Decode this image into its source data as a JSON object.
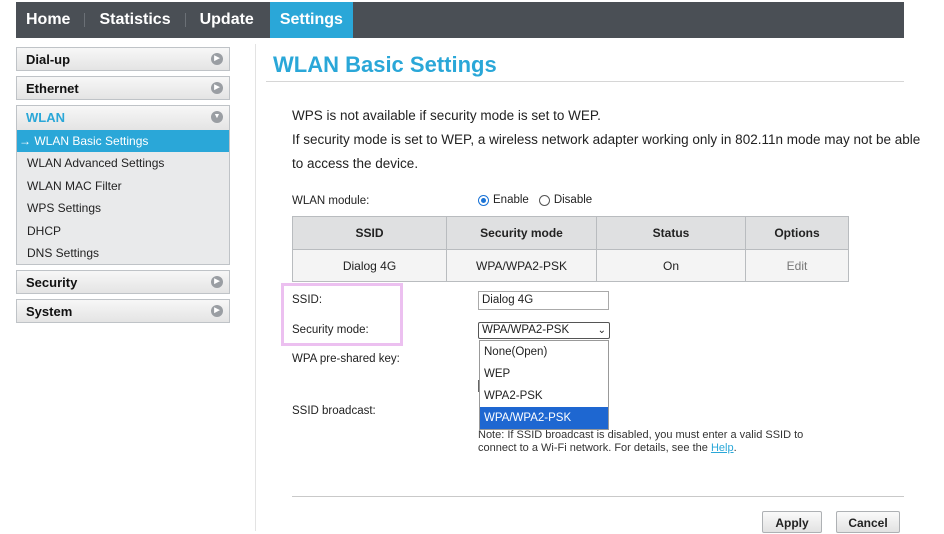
{
  "topnav": {
    "tabs": [
      "Home",
      "Statistics",
      "Update",
      "Settings"
    ],
    "active": "Settings"
  },
  "sidebar": {
    "dialup": "Dial-up",
    "ethernet": "Ethernet",
    "wlan": "WLAN",
    "wlan_items": [
      "→ WLAN Basic Settings",
      "WLAN Advanced Settings",
      "WLAN MAC Filter",
      "WPS Settings",
      "DHCP",
      "DNS Settings"
    ],
    "security": "Security",
    "system": "System"
  },
  "main": {
    "title": "WLAN Basic Settings",
    "note1": "WPS is not available if security mode is set to WEP.",
    "note2": "If security mode is set to WEP, a wireless network adapter working only in 802.11n mode may not be able",
    "note3": "to access the device.",
    "wlan_module_label": "WLAN module:",
    "enable_label": "Enable",
    "disable_label": "Disable",
    "table_headers": [
      "SSID",
      "Security mode",
      "Status",
      "Options"
    ],
    "table_row": [
      "Dialog 4G",
      "WPA/WPA2-PSK",
      "On",
      "Edit"
    ],
    "ssid_label": "SSID:",
    "ssid_value": "Dialog 4G",
    "security_mode_label": "Security mode:",
    "security_mode_value": "WPA/WPA2-PSK",
    "security_mode_options": [
      "None(Open)",
      "WEP",
      "WPA2-PSK",
      "WPA/WPA2-PSK"
    ],
    "psk_label": "WPA pre-shared key:",
    "ssid_broadcast_label": "SSID broadcast:",
    "help_note": "Note: If SSID broadcast is disabled, you must enter a valid SSID to connect to a Wi-Fi network. For details, see the",
    "help_link": "Help",
    "apply": "Apply",
    "cancel": "Cancel"
  },
  "colors": {
    "accent": "#2aa7d8",
    "nav_bg": "#4a4f55",
    "selected_option": "#1e67d1"
  }
}
